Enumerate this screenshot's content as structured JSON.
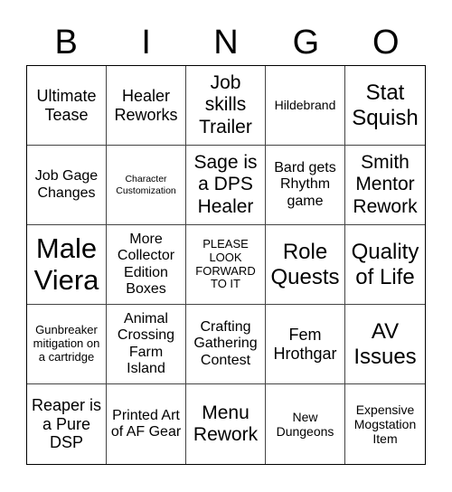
{
  "header": {
    "letters": [
      "B",
      "I",
      "N",
      "G",
      "O"
    ]
  },
  "cells": [
    "Ultimate Tease",
    "Healer Reworks",
    "Job skills Trailer",
    "Hildebrand",
    "Stat Squish",
    "Job Gage Changes",
    "Character Customization",
    "Sage is a DPS Healer",
    "Bard gets Rhythm game",
    "Smith Mentor Rework",
    "Male Viera",
    "More Collector Edition Boxes",
    "PLEASE LOOK FORWARD TO IT",
    "Role Quests",
    "Quality of Life",
    "Gunbreaker mitigation on a cartridge",
    "Animal Crossing Farm Island",
    "Crafting Gathering Contest",
    "Fem Hrothgar",
    "AV Issues",
    "Reaper is a Pure DSP",
    "Printed Art of AF Gear",
    "Menu Rework",
    "New Dungeons",
    "Expensive Mogstation Item"
  ]
}
